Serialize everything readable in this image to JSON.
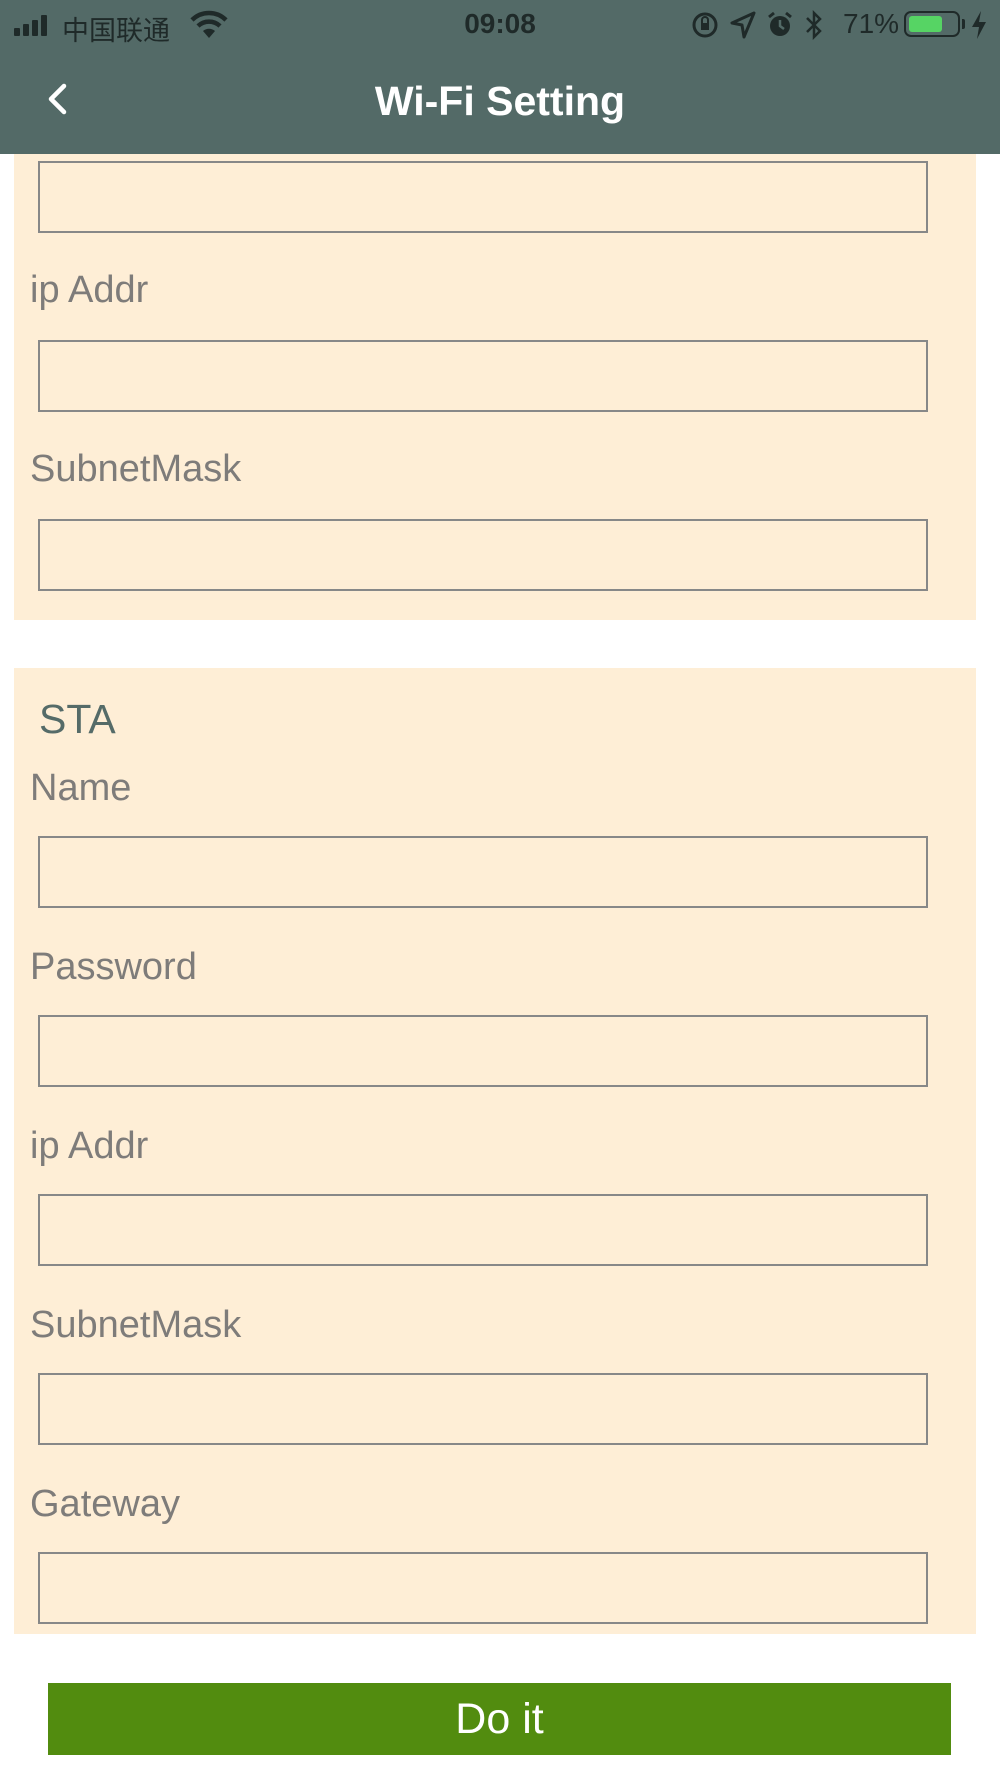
{
  "status_bar": {
    "carrier": "中国联通",
    "time": "09:08",
    "battery_percent": "71%",
    "battery_level": 0.71,
    "icons": [
      "signal-icon",
      "wifi-icon",
      "orientation-lock-icon",
      "location-icon",
      "alarm-icon",
      "bluetooth-icon",
      "battery-icon",
      "charging-icon"
    ]
  },
  "nav": {
    "title": "Wi-Fi Setting",
    "back_icon": "chevron-left-icon"
  },
  "ap_section": {
    "fields": [
      {
        "label": "",
        "value": ""
      },
      {
        "label": "ip Addr",
        "value": ""
      },
      {
        "label": "SubnetMask",
        "value": ""
      }
    ]
  },
  "sta_section": {
    "title": "STA",
    "fields": [
      {
        "label": "Name",
        "value": ""
      },
      {
        "label": "Password",
        "value": ""
      },
      {
        "label": "ip Addr",
        "value": ""
      },
      {
        "label": "SubnetMask",
        "value": ""
      },
      {
        "label": "Gateway",
        "value": ""
      }
    ]
  },
  "submit": {
    "label": "Do it"
  },
  "colors": {
    "header": "#536a67",
    "card_background": "#feeed6",
    "button": "#528c0f",
    "label": "#7e7c7a",
    "section_title": "#556b68"
  }
}
